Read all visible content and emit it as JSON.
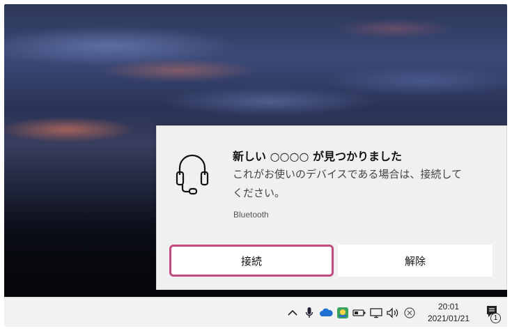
{
  "notification": {
    "icon": "headset-icon",
    "title": "新しい ○○○○ が見つかりました",
    "message": "これがお使いのデバイスである場合は、接続してください。",
    "attribution": "Bluetooth",
    "actions": {
      "connect_label": "接続",
      "dismiss_label": "解除"
    },
    "highlight_color": "#c14a7e"
  },
  "taskbar": {
    "tray_icons": [
      "chevron-up-icon",
      "microphone-icon",
      "onedrive-cloud-icon",
      "app-tray-icon",
      "battery-icon",
      "network-icon",
      "volume-icon",
      "close-circle-icon"
    ],
    "clock": {
      "time": "20:01",
      "date": "2021/01/21"
    },
    "notification_badge": "1"
  }
}
